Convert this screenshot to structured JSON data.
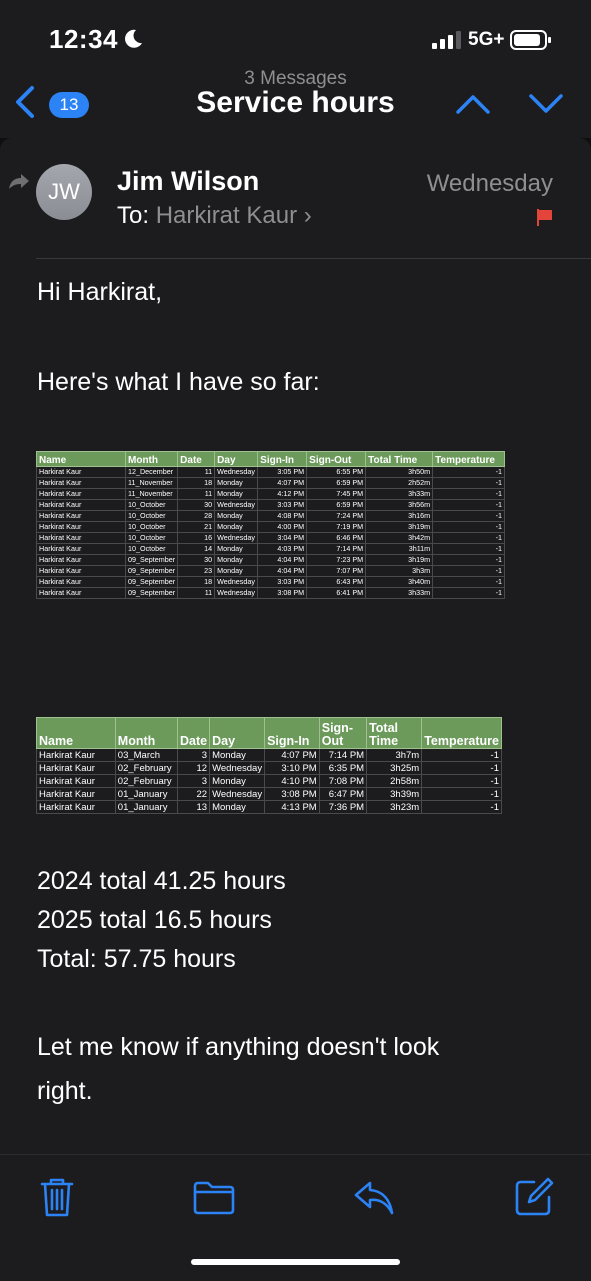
{
  "status_bar": {
    "time": "12:34",
    "network": "5G+"
  },
  "nav": {
    "back_count": "13",
    "subtitle": "3 Messages",
    "title": "Service hours"
  },
  "message": {
    "avatar_initials": "JW",
    "sender": "Jim Wilson",
    "to_label": "To:",
    "to_name": "Harkirat Kaur",
    "date": "Wednesday",
    "greeting": "Hi Harkirat,",
    "intro": "Here's what I have so far:",
    "totals": [
      "2024 total 41.25 hours",
      "2025 total 16.5 hours",
      "Total: 57.75 hours"
    ],
    "closing_line1": "Let me know if anything doesn't look",
    "closing_line2": "right."
  },
  "table_2024": {
    "headers": [
      "Name",
      "Month",
      "Date",
      "Day",
      "Sign-In",
      "Sign-Out",
      "Total Time",
      "Temperature"
    ],
    "rows": [
      [
        "Harkirat Kaur",
        "12_December",
        "11",
        "Wednesday",
        "3:05 PM",
        "6:55 PM",
        "3h50m",
        "-1"
      ],
      [
        "Harkirat Kaur",
        "11_November",
        "18",
        "Monday",
        "4:07 PM",
        "6:59 PM",
        "2h52m",
        "-1"
      ],
      [
        "Harkirat Kaur",
        "11_November",
        "11",
        "Monday",
        "4:12 PM",
        "7:45 PM",
        "3h33m",
        "-1"
      ],
      [
        "Harkirat Kaur",
        "10_October",
        "30",
        "Wednesday",
        "3:03 PM",
        "6:59 PM",
        "3h56m",
        "-1"
      ],
      [
        "Harkirat Kaur",
        "10_October",
        "28",
        "Monday",
        "4:08 PM",
        "7:24 PM",
        "3h16m",
        "-1"
      ],
      [
        "Harkirat Kaur",
        "10_October",
        "21",
        "Monday",
        "4:00 PM",
        "7:19 PM",
        "3h19m",
        "-1"
      ],
      [
        "Harkirat Kaur",
        "10_October",
        "16",
        "Wednesday",
        "3:04 PM",
        "6:46 PM",
        "3h42m",
        "-1"
      ],
      [
        "Harkirat Kaur",
        "10_October",
        "14",
        "Monday",
        "4:03 PM",
        "7:14 PM",
        "3h11m",
        "-1"
      ],
      [
        "Harkirat Kaur",
        "09_September",
        "30",
        "Monday",
        "4:04 PM",
        "7:23 PM",
        "3h19m",
        "-1"
      ],
      [
        "Harkirat Kaur",
        "09_September",
        "23",
        "Monday",
        "4:04 PM",
        "7:07 PM",
        "3h3m",
        "-1"
      ],
      [
        "Harkirat Kaur",
        "09_September",
        "18",
        "Wednesday",
        "3:03 PM",
        "6:43 PM",
        "3h40m",
        "-1"
      ],
      [
        "Harkirat Kaur",
        "09_September",
        "11",
        "Wednesday",
        "3:08 PM",
        "6:41 PM",
        "3h33m",
        "-1"
      ]
    ]
  },
  "table_2025": {
    "headers": [
      "Name",
      "Month",
      "Date",
      "Day",
      "Sign-In",
      "Sign-Out",
      "Total Time",
      "Temperature"
    ],
    "rows": [
      [
        "Harkirat Kaur",
        "03_March",
        "3",
        "Monday",
        "4:07 PM",
        "7:14 PM",
        "3h7m",
        "-1"
      ],
      [
        "Harkirat Kaur",
        "02_February",
        "12",
        "Wednesday",
        "3:10 PM",
        "6:35 PM",
        "3h25m",
        "-1"
      ],
      [
        "Harkirat Kaur",
        "02_February",
        "3",
        "Monday",
        "4:10 PM",
        "7:08 PM",
        "2h58m",
        "-1"
      ],
      [
        "Harkirat Kaur",
        "01_January",
        "22",
        "Wednesday",
        "3:08 PM",
        "6:47 PM",
        "3h39m",
        "-1"
      ],
      [
        "Harkirat Kaur",
        "01_January",
        "13",
        "Monday",
        "4:13 PM",
        "7:36 PM",
        "3h23m",
        "-1"
      ]
    ]
  },
  "toolbar": {
    "icons": [
      "trash-icon",
      "folder-icon",
      "reply-icon",
      "compose-icon"
    ]
  },
  "colors": {
    "accent": "#2b83f6",
    "flag": "#e5443a",
    "table_header": "#6b9a5b"
  }
}
